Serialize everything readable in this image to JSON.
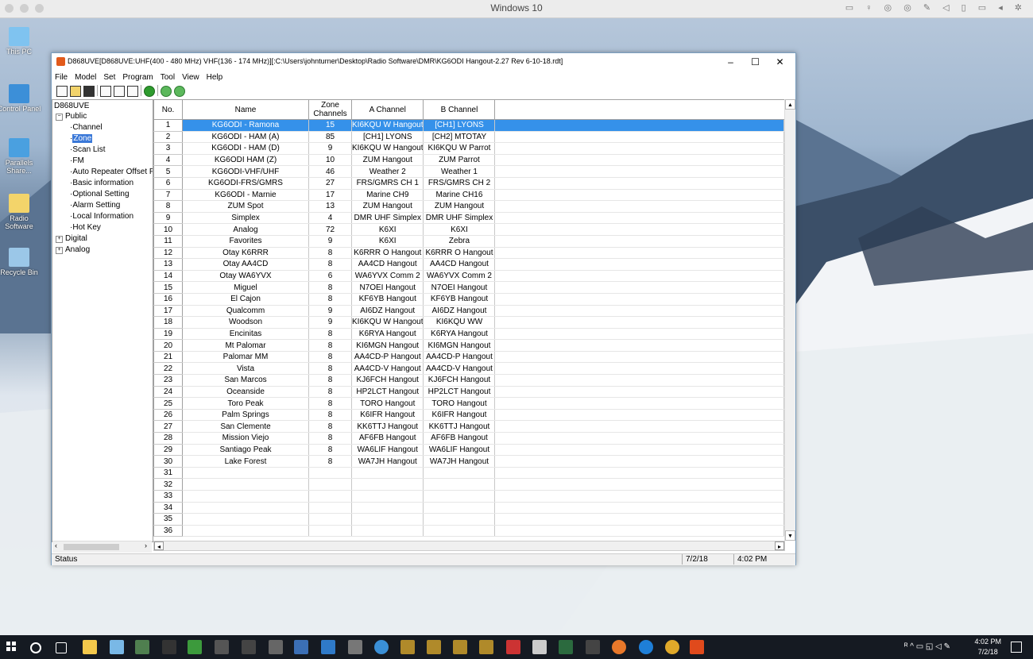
{
  "host": {
    "title": "Windows 10"
  },
  "desktop_icons": [
    {
      "label": "This PC"
    },
    {
      "label": "Control Panel"
    },
    {
      "label": "Parallels Share..."
    },
    {
      "label": "Radio Software"
    },
    {
      "label": "Recycle Bin"
    }
  ],
  "window": {
    "title": "D868UVE[D868UVE:UHF(400 - 480 MHz) VHF(136 - 174 MHz)][:C:\\Users\\johnturner\\Desktop\\Radio Software\\DMR\\KG6ODI Hangout-2.27 Rev 6-10-18.rdt]",
    "controls": {
      "minimize": "–",
      "maximize": "☐",
      "close": "✕"
    }
  },
  "menu": [
    "File",
    "Model",
    "Set",
    "Program",
    "Tool",
    "View",
    "Help"
  ],
  "tree": {
    "root": "D868UVE",
    "public": "Public",
    "items": [
      "Channel",
      "Zone",
      "Scan List",
      "FM",
      "Auto Repeater Offset F",
      "Basic information",
      "Optional Setting",
      "Alarm Setting",
      "Local Information",
      "Hot Key"
    ],
    "selected": "Zone",
    "digital": "Digital",
    "analog": "Analog",
    "expand_sym": "+",
    "collapse_sym": "−"
  },
  "table": {
    "headers": {
      "no": "No.",
      "name": "Name",
      "zone_channels": "Zone Channels",
      "a_channel": "A Channel",
      "b_channel": "B Channel"
    },
    "selected_row": 1,
    "rows": [
      {
        "no": "1",
        "name": "KG6ODI - Ramona",
        "zone": "15",
        "a": "KI6KQU W Hangout",
        "b": "[CH1] LYONS"
      },
      {
        "no": "2",
        "name": "KG6ODI - HAM (A)",
        "zone": "85",
        "a": "[CH1] LYONS",
        "b": "[CH2] MTOTAY"
      },
      {
        "no": "3",
        "name": "KG6ODI - HAM (D)",
        "zone": "9",
        "a": "KI6KQU W Hangout",
        "b": "KI6KQU W Parrot"
      },
      {
        "no": "4",
        "name": "KG6ODI HAM (Z)",
        "zone": "10",
        "a": "ZUM Hangout",
        "b": "ZUM Parrot"
      },
      {
        "no": "5",
        "name": "KG6ODI-VHF/UHF",
        "zone": "46",
        "a": "Weather 2",
        "b": "Weather 1"
      },
      {
        "no": "6",
        "name": "KG6ODI-FRS/GMRS",
        "zone": "27",
        "a": "FRS/GMRS CH 1",
        "b": "FRS/GMRS CH 2"
      },
      {
        "no": "7",
        "name": "KG6ODI - Marnie",
        "zone": "17",
        "a": "Marine CH9",
        "b": "Marine CH16"
      },
      {
        "no": "8",
        "name": "ZUM Spot",
        "zone": "13",
        "a": "ZUM Hangout",
        "b": "ZUM Hangout"
      },
      {
        "no": "9",
        "name": "Simplex",
        "zone": "4",
        "a": "DMR UHF Simplex",
        "b": "DMR UHF Simplex"
      },
      {
        "no": "10",
        "name": "Analog",
        "zone": "72",
        "a": "K6XI",
        "b": "K6XI"
      },
      {
        "no": "11",
        "name": "Favorites",
        "zone": "9",
        "a": "K6XI",
        "b": "Zebra"
      },
      {
        "no": "12",
        "name": "Otay K6RRR",
        "zone": "8",
        "a": "K6RRR O Hangout",
        "b": "K6RRR O Hangout"
      },
      {
        "no": "13",
        "name": "Otay AA4CD",
        "zone": "8",
        "a": "AA4CD Hangout",
        "b": "AA4CD Hangout"
      },
      {
        "no": "14",
        "name": "Otay WA6YVX",
        "zone": "6",
        "a": "WA6YVX Comm 2",
        "b": "WA6YVX Comm 2"
      },
      {
        "no": "15",
        "name": "Miguel",
        "zone": "8",
        "a": "N7OEI Hangout",
        "b": "N7OEI Hangout"
      },
      {
        "no": "16",
        "name": "El Cajon",
        "zone": "8",
        "a": "KF6YB Hangout",
        "b": "KF6YB Hangout"
      },
      {
        "no": "17",
        "name": "Qualcomm",
        "zone": "9",
        "a": "AI6DZ Hangout",
        "b": "AI6DZ Hangout"
      },
      {
        "no": "18",
        "name": "Woodson",
        "zone": "9",
        "a": "KI6KQU W Hangout",
        "b": "KI6KQU WW"
      },
      {
        "no": "19",
        "name": "Encinitas",
        "zone": "8",
        "a": "K6RYA Hangout",
        "b": "K6RYA Hangout"
      },
      {
        "no": "20",
        "name": "Mt Palomar",
        "zone": "8",
        "a": "KI6MGN Hangout",
        "b": "KI6MGN Hangout"
      },
      {
        "no": "21",
        "name": "Palomar MM",
        "zone": "8",
        "a": "AA4CD-P Hangout",
        "b": "AA4CD-P Hangout"
      },
      {
        "no": "22",
        "name": "Vista",
        "zone": "8",
        "a": "AA4CD-V Hangout",
        "b": "AA4CD-V Hangout"
      },
      {
        "no": "23",
        "name": "San Marcos",
        "zone": "8",
        "a": "KJ6FCH Hangout",
        "b": "KJ6FCH Hangout"
      },
      {
        "no": "24",
        "name": "Oceanside",
        "zone": "8",
        "a": "HP2LCT Hangout",
        "b": "HP2LCT Hangout"
      },
      {
        "no": "25",
        "name": "Toro Peak",
        "zone": "8",
        "a": "TORO Hangout",
        "b": "TORO Hangout"
      },
      {
        "no": "26",
        "name": "Palm Springs",
        "zone": "8",
        "a": "K6IFR Hangout",
        "b": "K6IFR Hangout"
      },
      {
        "no": "27",
        "name": "San Clemente",
        "zone": "8",
        "a": "KK6TTJ Hangout",
        "b": "KK6TTJ Hangout"
      },
      {
        "no": "28",
        "name": "Mission Viejo",
        "zone": "8",
        "a": "AF6FB Hangout",
        "b": "AF6FB Hangout"
      },
      {
        "no": "29",
        "name": "Santiago Peak",
        "zone": "8",
        "a": "WA6LIF Hangout",
        "b": "WA6LIF Hangout"
      },
      {
        "no": "30",
        "name": "Lake Forest",
        "zone": "8",
        "a": "WA7JH Hangout",
        "b": "WA7JH Hangout"
      },
      {
        "no": "31",
        "name": "",
        "zone": "",
        "a": "",
        "b": ""
      },
      {
        "no": "32",
        "name": "",
        "zone": "",
        "a": "",
        "b": ""
      },
      {
        "no": "33",
        "name": "",
        "zone": "",
        "a": "",
        "b": ""
      },
      {
        "no": "34",
        "name": "",
        "zone": "",
        "a": "",
        "b": ""
      },
      {
        "no": "35",
        "name": "",
        "zone": "",
        "a": "",
        "b": ""
      },
      {
        "no": "36",
        "name": "",
        "zone": "",
        "a": "",
        "b": ""
      }
    ]
  },
  "status": {
    "label": "Status",
    "date": "7/2/18",
    "time": "4:02 PM"
  },
  "taskbar": {
    "time": "4:02 PM",
    "date": "7/2/18"
  },
  "colors": {
    "selection": "#3591ea",
    "tree_selection": "#3a78d8",
    "taskbar": "#151a22"
  }
}
